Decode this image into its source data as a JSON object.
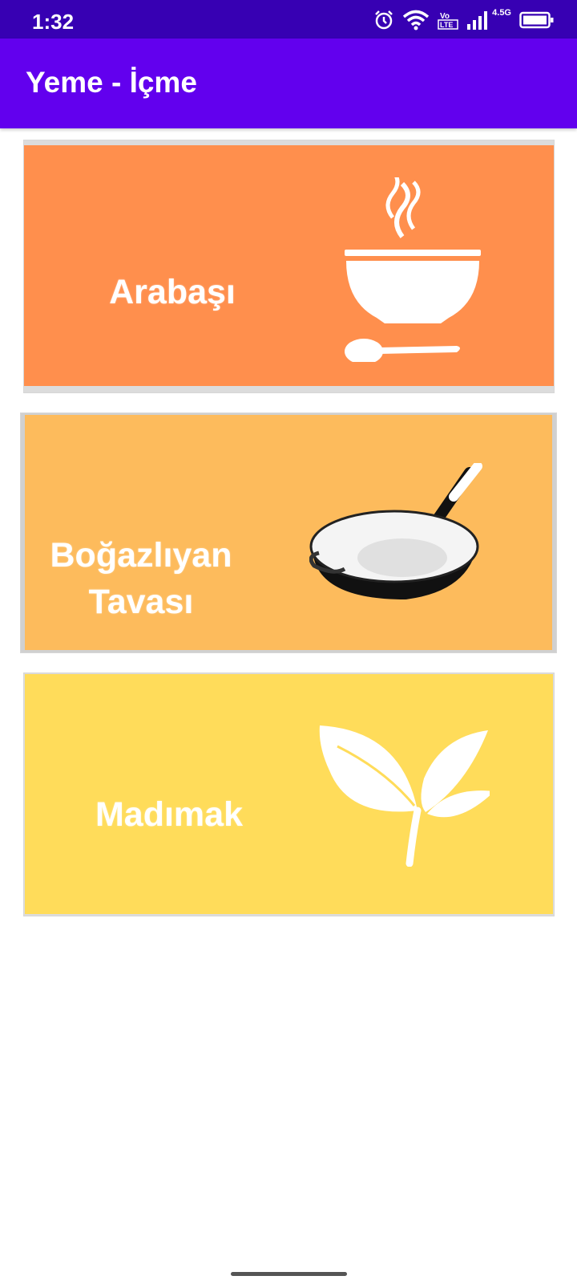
{
  "status_bar": {
    "time": "1:32",
    "network": "4.5G",
    "icons": [
      "alarm-icon",
      "wifi-icon",
      "volte-icon",
      "signal-icon",
      "battery-icon"
    ]
  },
  "app_bar": {
    "title": "Yeme - İçme"
  },
  "cards": [
    {
      "label": "Arabaşı",
      "icon": "soup-bowl-icon",
      "color": "#ff8f4d"
    },
    {
      "label_line1": "Boğazlıyan",
      "label_line2": "Tavası",
      "icon": "frying-pan-icon",
      "color": "#fdbb5c"
    },
    {
      "label": "Madımak",
      "icon": "leaf-icon",
      "color": "#ffdc5a"
    }
  ],
  "colors": {
    "status_bar": "#3700b3",
    "app_bar": "#6200ee"
  }
}
